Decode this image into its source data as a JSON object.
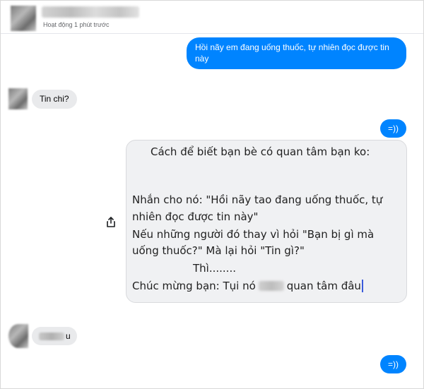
{
  "header": {
    "status": "Hoạt động 1 phút trước"
  },
  "messages": {
    "out_1": "Hồi nãy em đang uống thuốc, tự nhiên đọc được tin này",
    "in_1": "Tin chi?",
    "out_2": "=))",
    "in_2_suffix": "u",
    "out_3": "=))"
  },
  "shared_image": {
    "title": "Cách để biết bạn bè có quan tâm bạn ko:",
    "line1": "Nhắn cho nó: \"Hồi nãy tao đang uống thuốc, tự",
    "line2": "nhiên đọc được tin này\"",
    "line3": "Nếu những người đó thay vì hỏi \"Bạn bị gì mà",
    "line4": "uống thuốc?\" Mà lại hỏi \"Tin gì?\"",
    "line5": "Thì........",
    "line6_a": "Chúc mừng bạn: Tụi nó",
    "line6_b": "quan tâm đâu"
  },
  "colors": {
    "outgoing_bubble": "#0084ff",
    "incoming_bubble": "#e9eaec",
    "status_text": "#65676b"
  },
  "icons": {
    "share": "share-icon"
  }
}
